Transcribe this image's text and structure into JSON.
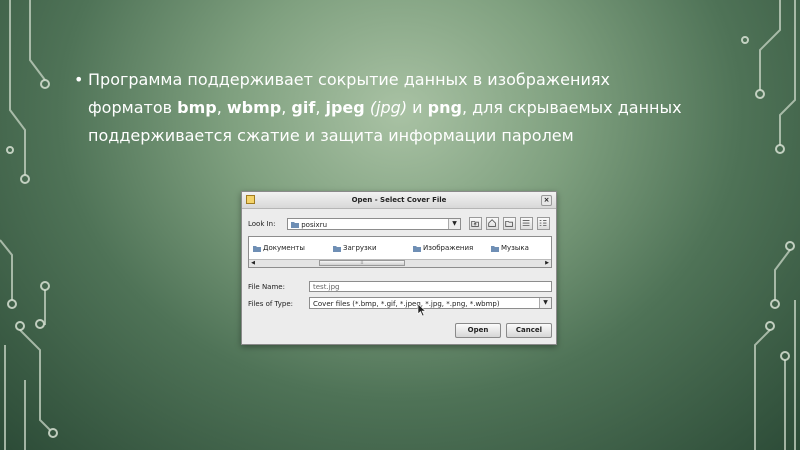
{
  "slide": {
    "line1": "Программа поддерживает сокрытие данных в изображениях",
    "l2_prefix": "форматов ",
    "fmt1": "bmp",
    "sep": ", ",
    "fmt2": "wbmp",
    "fmt3": "gif",
    "fmt4": "jpeg",
    "jpg_paren": " (jpg) ",
    "and": "и ",
    "fmt5": "png",
    "l2_suffix": ", для скрываемых данных",
    "line3": "поддерживается сжатие и защита информации паролем"
  },
  "dialog": {
    "title": "Open - Select Cover File",
    "look_in_label": "Look In:",
    "look_in_value": "posixru",
    "folders": [
      "Документы",
      "Загрузки",
      "Изображения",
      "Музыка"
    ],
    "file_name_label": "File Name:",
    "file_name_value": "test.jpg",
    "file_type_label": "Files of Type:",
    "file_type_value": "Cover files (*.bmp, *.gif, *.jpeg, *.jpg, *.png, *.wbmp)",
    "open_label": "Open",
    "cancel_label": "Cancel"
  },
  "colors": {
    "folder": "#6f8fb5",
    "text": "#ffffff"
  }
}
